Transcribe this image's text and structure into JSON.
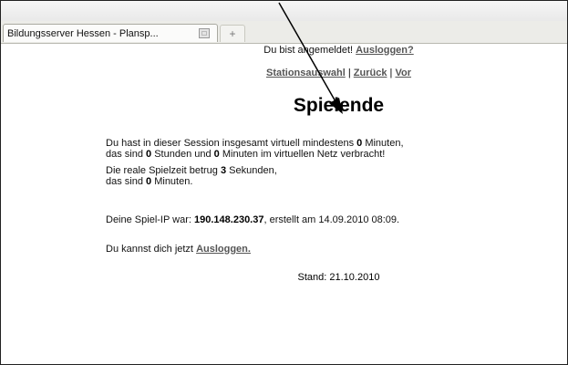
{
  "tab": {
    "title": "Bildungsserver Hessen - Plansp...",
    "newtab": "+"
  },
  "header": {
    "logged_in": "Du bist angemeldet!",
    "logout": "Ausloggen?"
  },
  "nav": {
    "station": "Stationsauswahl",
    "sep": " | ",
    "back": "Zurück",
    "forward": "Vor"
  },
  "main": {
    "title": "Spielende",
    "p1_a": "Du hast in dieser Session insgesamt virtuell mindestens ",
    "p1_b": "0",
    "p1_c": " Minuten,",
    "p1_d": "das sind ",
    "p1_e": "0",
    "p1_f": " Stunden und ",
    "p1_g": "0",
    "p1_h": " Minuten im virtuellen Netz verbracht!",
    "p2_a": "Die reale Spielzeit betrug ",
    "p2_b": "3",
    "p2_c": " Sekunden,",
    "p2_d": "das sind ",
    "p2_e": "0",
    "p2_f": " Minuten.",
    "ip_a": "Deine Spiel-IP war: ",
    "ip_b": "190.148.230.37",
    "ip_c": ", erstellt am 14.09.2010 08:09.",
    "logout_a": "Du kannst dich jetzt ",
    "logout_b": "Ausloggen.",
    "stand": "Stand: 21.10.2010"
  }
}
